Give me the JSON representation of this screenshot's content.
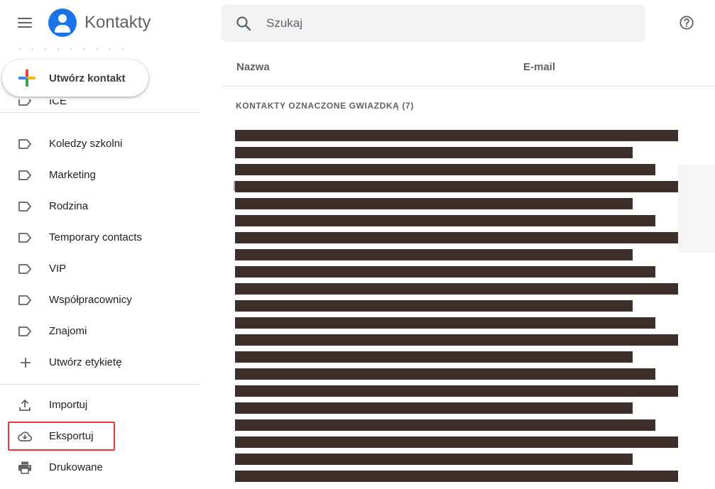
{
  "header": {
    "app_title": "Kontakty",
    "search_placeholder": "Szukaj",
    "icons": {
      "menu": "hamburger-menu-icon",
      "search": "search-icon",
      "help": "help-icon",
      "logo": "contacts-logo-icon"
    }
  },
  "sidebar": {
    "create_contact_label": "Utwórz kontakt",
    "partial_label": "ICE",
    "labels": [
      "Koledzy szkolni",
      "Marketing",
      "Rodzina",
      "Temporary contacts",
      "VIP",
      "Współpracownicy",
      "Znajomi"
    ],
    "create_label": "Utwórz etykietę",
    "actions": [
      {
        "label": "Importuj",
        "icon": "upload-icon"
      },
      {
        "label": "Eksportuj",
        "icon": "cloud-download-icon",
        "highlighted": true
      },
      {
        "label": "Drukowane",
        "icon": "printer-icon"
      }
    ]
  },
  "main": {
    "columns": {
      "name": "Nazwa",
      "email": "E-mail"
    },
    "section_title": "KONTAKTY OZNACZONE GWIAZDKĄ (7)",
    "redacted_color": "#3e2f2c"
  },
  "colors": {
    "accent": "#1a73e8",
    "highlight": "#e53935"
  }
}
